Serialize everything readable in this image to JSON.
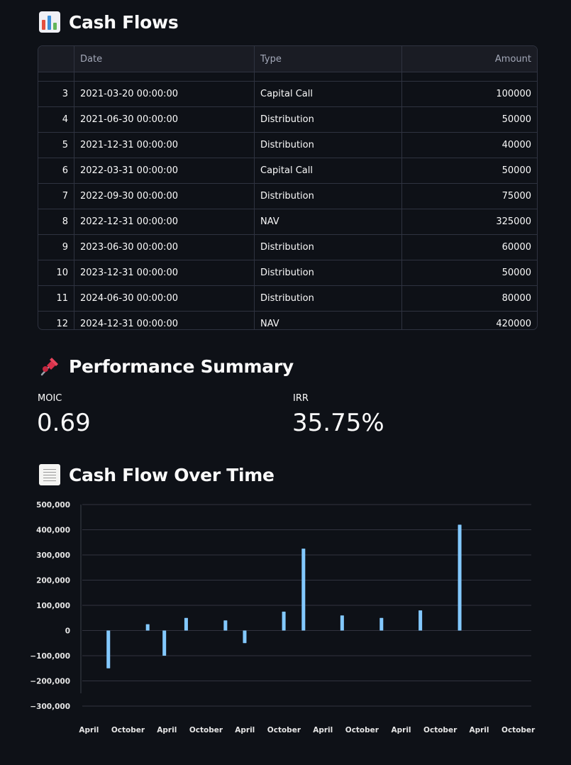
{
  "sections": {
    "cash_flows_title": "Cash Flows",
    "performance_title": "Performance Summary",
    "chart_title": "Cash Flow Over Time"
  },
  "table": {
    "columns": [
      "",
      "Date",
      "Type",
      "Amount"
    ],
    "rows": [
      {
        "index": "3",
        "date": "2021-03-20 00:00:00",
        "type": "Capital Call",
        "amount": "100000"
      },
      {
        "index": "4",
        "date": "2021-06-30 00:00:00",
        "type": "Distribution",
        "amount": "50000"
      },
      {
        "index": "5",
        "date": "2021-12-31 00:00:00",
        "type": "Distribution",
        "amount": "40000"
      },
      {
        "index": "6",
        "date": "2022-03-31 00:00:00",
        "type": "Capital Call",
        "amount": "50000"
      },
      {
        "index": "7",
        "date": "2022-09-30 00:00:00",
        "type": "Distribution",
        "amount": "75000"
      },
      {
        "index": "8",
        "date": "2022-12-31 00:00:00",
        "type": "NAV",
        "amount": "325000"
      },
      {
        "index": "9",
        "date": "2023-06-30 00:00:00",
        "type": "Distribution",
        "amount": "60000"
      },
      {
        "index": "10",
        "date": "2023-12-31 00:00:00",
        "type": "Distribution",
        "amount": "50000"
      },
      {
        "index": "11",
        "date": "2024-06-30 00:00:00",
        "type": "Distribution",
        "amount": "80000"
      },
      {
        "index": "12",
        "date": "2024-12-31 00:00:00",
        "type": "NAV",
        "amount": "420000"
      }
    ]
  },
  "metrics": {
    "moic_label": "MOIC",
    "moic_value": "0.69",
    "irr_label": "IRR",
    "irr_value": "35.75%"
  },
  "icons": {
    "cash_flows": "bar-chart-icon",
    "performance": "pushpin-icon",
    "chart": "receipt-icon"
  },
  "chart_data": {
    "type": "bar",
    "color": "#83c9ff",
    "grid": true,
    "x": [
      "2020-07-01",
      "2021-01-01",
      "2021-03-20",
      "2021-06-30",
      "2021-12-31",
      "2022-03-31",
      "2022-09-30",
      "2022-12-31",
      "2023-06-30",
      "2023-12-31",
      "2024-06-30",
      "2024-12-31"
    ],
    "values": [
      -150000,
      25000,
      -100000,
      50000,
      40000,
      -50000,
      75000,
      325000,
      60000,
      50000,
      80000,
      420000
    ],
    "ylim": [
      -300000,
      500000
    ],
    "yticks": [
      500000,
      400000,
      300000,
      200000,
      100000,
      0,
      -100000,
      -200000,
      -300000
    ],
    "ytick_labels": [
      "500,000",
      "400,000",
      "300,000",
      "200,000",
      "100,000",
      "0",
      "−100,000",
      "−200,000",
      "−300,000"
    ],
    "xticks": [
      "2020-04-01",
      "2020-10-01",
      "2021-04-01",
      "2021-10-01",
      "2022-04-01",
      "2022-10-01",
      "2023-04-01",
      "2023-10-01",
      "2024-04-01",
      "2024-10-01",
      "2025-04-01",
      "2025-10-01"
    ],
    "xtick_labels": [
      "April",
      "October",
      "April",
      "October",
      "April",
      "October",
      "April",
      "October",
      "April",
      "October",
      "April",
      "October"
    ],
    "xlim": [
      "2020-03-01",
      "2025-12-01"
    ]
  }
}
